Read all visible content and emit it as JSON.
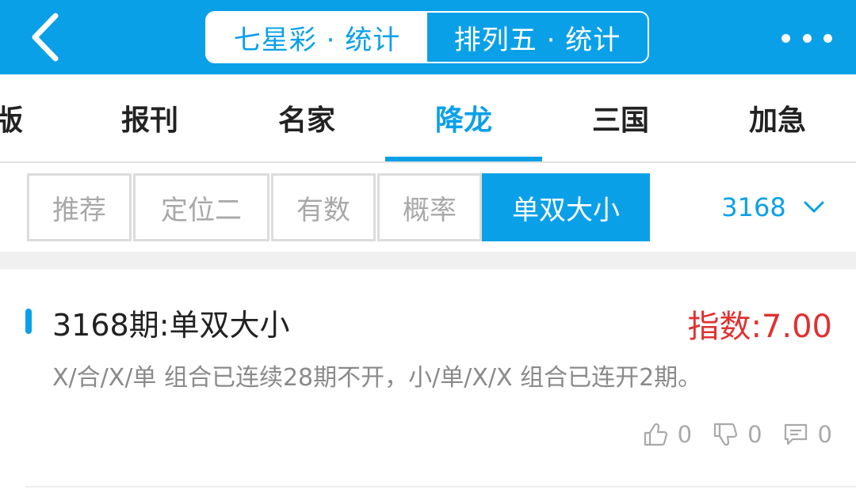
{
  "header": {
    "segments": [
      {
        "label": "七星彩 · 统计",
        "active": true
      },
      {
        "label": "排列五 · 统计",
        "active": false
      }
    ],
    "icons": {
      "back": "back-chevron-icon",
      "more": "more-dots-icon"
    },
    "colors": {
      "primary": "#0aa0e8",
      "white": "#ffffff"
    }
  },
  "category_tabs": {
    "items": [
      "版",
      "报刊",
      "名家",
      "降龙",
      "三国",
      "加急"
    ],
    "active": "降龙"
  },
  "filters": {
    "buttons": [
      "推荐",
      "定位二",
      "有数",
      "概率",
      "单双大小"
    ],
    "active": "单双大小",
    "issue_select": {
      "value": "3168",
      "icon": "chevron-down-icon"
    }
  },
  "article": {
    "title": "3168期:单双大小",
    "index": "指数:7.00",
    "description": "X/合/X/单 组合已连续28期不开，小/单/X/X 组合已连开2期。",
    "likes": "0",
    "dislikes": "0",
    "comments": "0",
    "colors": {
      "index": "#e03131",
      "desc": "#8a8a8a"
    }
  }
}
